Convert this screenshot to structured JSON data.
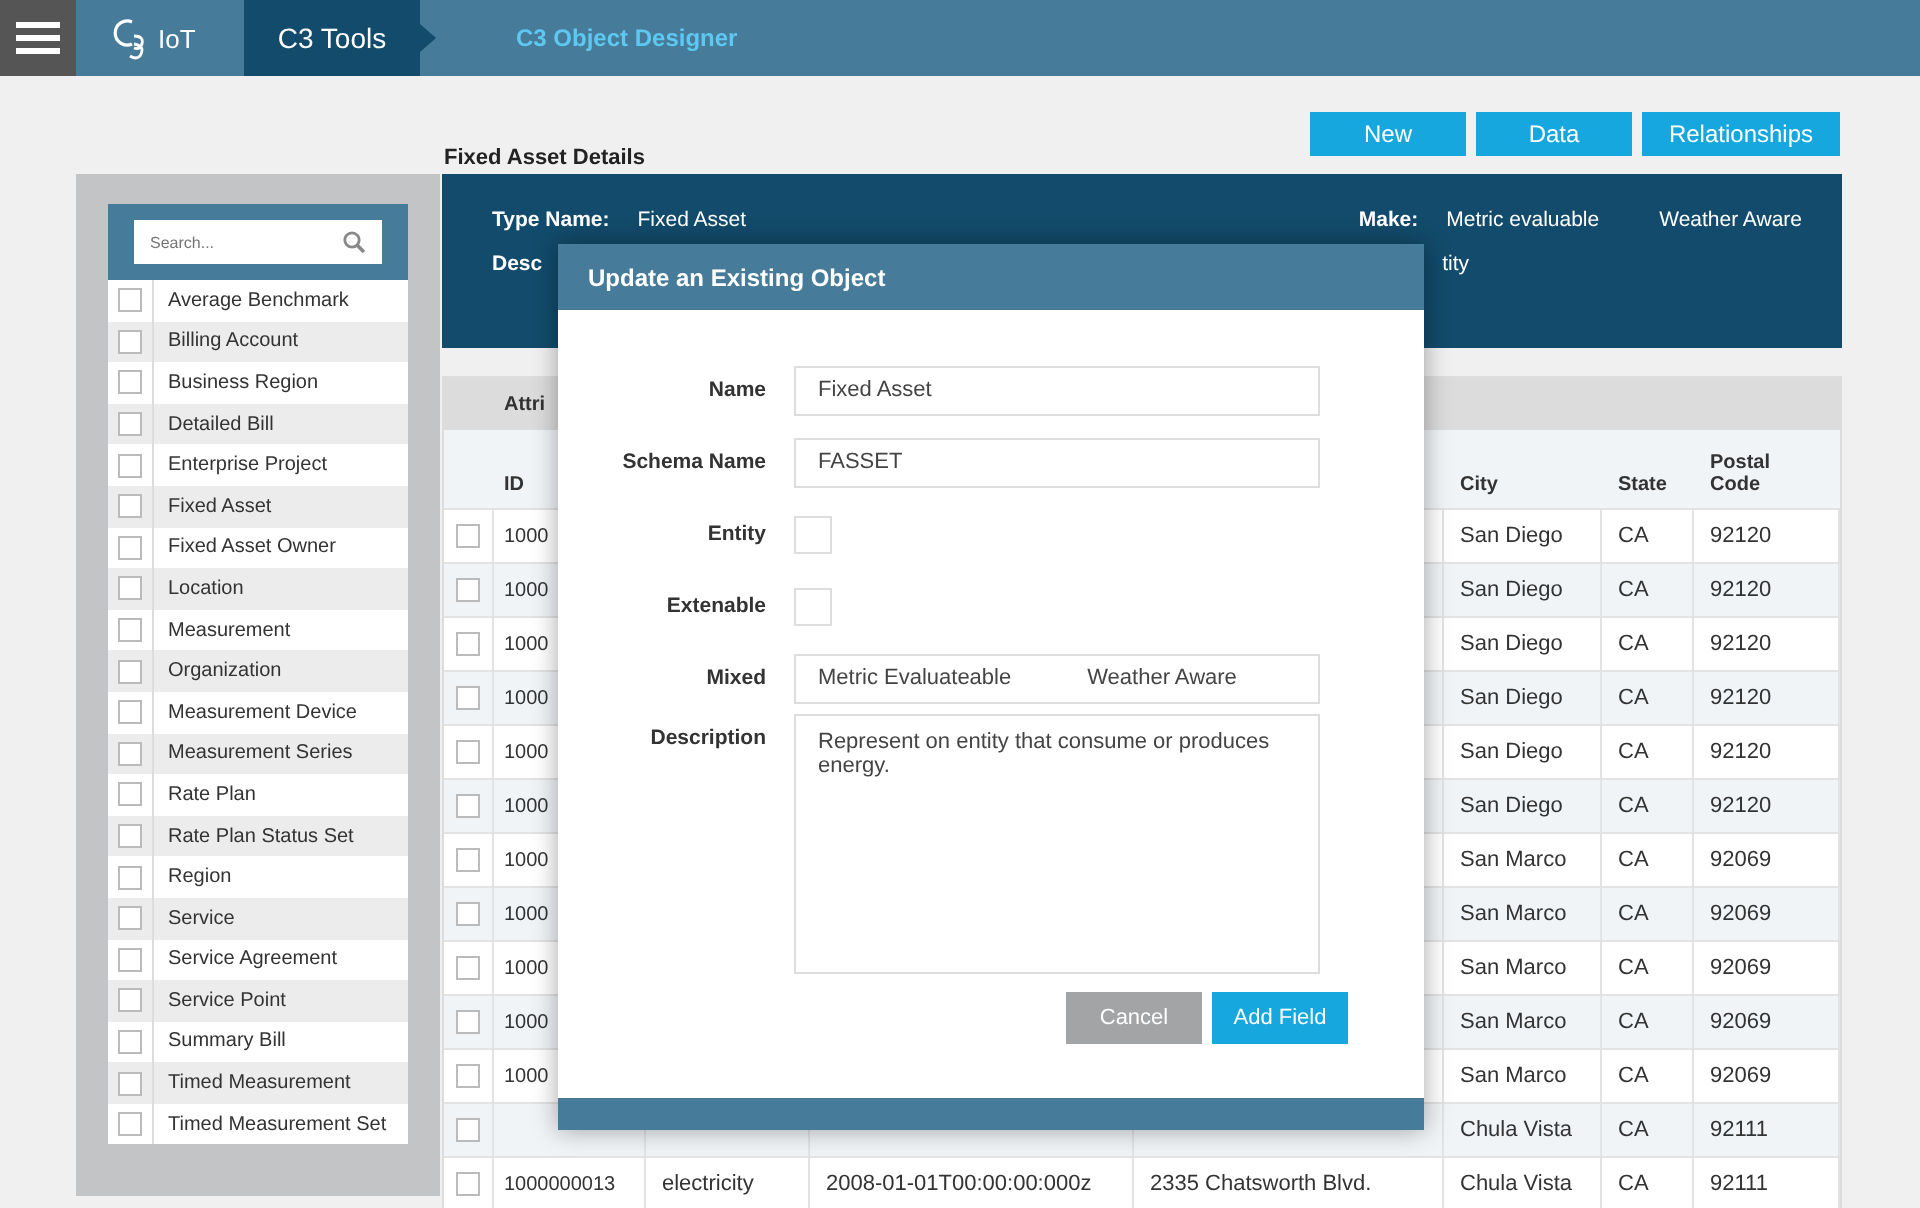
{
  "topbar": {
    "logo": "IoT",
    "app": "C3 Tools",
    "page": "C3 Object Designer"
  },
  "title": "Fixed Asset Details",
  "actions": [
    "New",
    "Data",
    "Relationships"
  ],
  "sidebar": {
    "search_placeholder": "Search...",
    "items": [
      {
        "label": "Average Benchmark",
        "checked": false
      },
      {
        "label": "Billing Account",
        "checked": false
      },
      {
        "label": "Business Region",
        "checked": false
      },
      {
        "label": "Detailed Bill",
        "checked": false
      },
      {
        "label": "Enterprise Project",
        "checked": false
      },
      {
        "label": "Fixed Asset",
        "checked": false
      },
      {
        "label": "Fixed Asset Owner",
        "checked": false
      },
      {
        "label": "Location",
        "checked": false
      },
      {
        "label": "Measurement",
        "checked": false
      },
      {
        "label": "Organization",
        "checked": false
      },
      {
        "label": "Measurement Device",
        "checked": false
      },
      {
        "label": "Measurement Series",
        "checked": false
      },
      {
        "label": "Rate Plan",
        "checked": false
      },
      {
        "label": "Rate Plan Status Set",
        "checked": false
      },
      {
        "label": "Region",
        "checked": false
      },
      {
        "label": "Service",
        "checked": false
      },
      {
        "label": "Service Agreement",
        "checked": false
      },
      {
        "label": "Service Point",
        "checked": false
      },
      {
        "label": "Summary Bill",
        "checked": false
      },
      {
        "label": "Timed Measurement",
        "checked": false
      },
      {
        "label": "Timed Measurement Set",
        "checked": false
      }
    ]
  },
  "details": {
    "type_label": "Type Name:",
    "type_value": "Fixed Asset",
    "desc_label": "Desc",
    "desc_tail": "tity",
    "make_label": "Make:",
    "make_values": [
      "Metric evaluable",
      "Weather Aware"
    ]
  },
  "table": {
    "tab": "Attri",
    "headers": {
      "id": "ID",
      "city": "City",
      "state": "State",
      "postal": "Postal Code"
    },
    "rows": [
      {
        "id": "1000",
        "city": "San Diego",
        "state": "CA",
        "postal": "92120",
        "checked": false
      },
      {
        "id": "1000",
        "city": "San Diego",
        "state": "CA",
        "postal": "92120",
        "checked": false
      },
      {
        "id": "1000",
        "city": "San Diego",
        "state": "CA",
        "postal": "92120",
        "checked": false
      },
      {
        "id": "1000",
        "city": "San Diego",
        "state": "CA",
        "postal": "92120",
        "checked": false
      },
      {
        "id": "1000",
        "city": "San Diego",
        "state": "CA",
        "postal": "92120",
        "checked": false
      },
      {
        "id": "1000",
        "city": "San Diego",
        "state": "CA",
        "postal": "92120",
        "checked": false
      },
      {
        "id": "1000",
        "city": "San Marco",
        "state": "CA",
        "postal": "92069",
        "checked": false
      },
      {
        "id": "1000",
        "city": "San Marco",
        "state": "CA",
        "postal": "92069",
        "checked": false
      },
      {
        "id": "1000",
        "city": "San Marco",
        "state": "CA",
        "postal": "92069",
        "checked": false
      },
      {
        "id": "1000",
        "city": "San Marco",
        "state": "CA",
        "postal": "92069",
        "checked": false
      },
      {
        "id": "1000",
        "city": "San Marco",
        "state": "CA",
        "postal": "92069",
        "checked": false
      },
      {
        "city": "Chula Vista",
        "state": "CA",
        "postal": "92111",
        "checked": false
      },
      {
        "id": "1000000013",
        "type": "electricity",
        "date": "2008-01-01T00:00:00:000z",
        "address": "2335 Chatsworth Blvd.",
        "city": "Chula Vista",
        "state": "CA",
        "postal": "92111",
        "checked": false
      }
    ]
  },
  "modal": {
    "title": "Update an Existing Object",
    "fields": [
      {
        "kind": "text",
        "label": "Name",
        "value": "Fixed Asset"
      },
      {
        "kind": "text",
        "label": "Schema Name",
        "value": "FASSET"
      },
      {
        "kind": "checkbox",
        "label": "Entity",
        "checked": false
      },
      {
        "kind": "checkbox",
        "label": "Extenable",
        "checked": false
      },
      {
        "kind": "pair",
        "label": "Mixed",
        "values": [
          "Metric Evaluateable",
          "Weather Aware"
        ]
      },
      {
        "kind": "textarea",
        "label": "Description",
        "value": "Represent on entity that consume or produces energy."
      }
    ],
    "buttons": [
      {
        "label": "Cancel",
        "kind": "secondary"
      },
      {
        "label": "Add Field",
        "kind": "primary"
      }
    ]
  }
}
